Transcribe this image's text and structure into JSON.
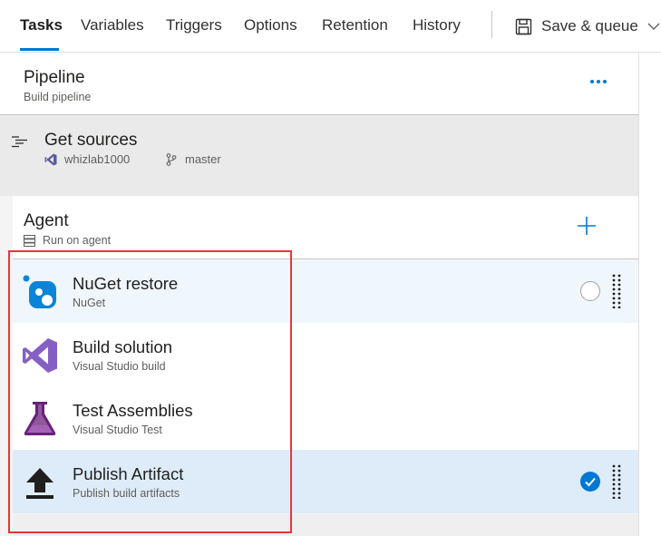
{
  "tabs": [
    {
      "label": "Tasks",
      "active": true
    },
    {
      "label": "Variables",
      "active": false
    },
    {
      "label": "Triggers",
      "active": false
    },
    {
      "label": "Options",
      "active": false
    },
    {
      "label": "Retention",
      "active": false
    },
    {
      "label": "History",
      "active": false
    }
  ],
  "toolbar": {
    "save_label": "Save & queue",
    "save_icon": "save-icon",
    "dropdown_icon": "chevron-down-icon"
  },
  "pipeline": {
    "title": "Pipeline",
    "subtitle": "Build pipeline",
    "more_icon": "more-icon"
  },
  "get_sources": {
    "title": "Get sources",
    "repo": "whizlab1000",
    "branch": "master"
  },
  "agent": {
    "title": "Agent",
    "subtitle": "Run on agent"
  },
  "tasks": [
    {
      "name": "NuGet restore",
      "type": "NuGet",
      "icon": "nuget-icon",
      "state": "hover"
    },
    {
      "name": "Build solution",
      "type": "Visual Studio build",
      "icon": "visual-studio-icon",
      "state": "normal"
    },
    {
      "name": "Test Assemblies",
      "type": "Visual Studio Test",
      "icon": "test-flask-icon",
      "state": "normal"
    },
    {
      "name": "Publish Artifact",
      "type": "Publish build artifacts",
      "icon": "upload-arrow-icon",
      "state": "selected"
    }
  ],
  "colors": {
    "accent": "#0078d4",
    "highlight_box": "#e03a3a",
    "hover_row": "#eff6fc",
    "selected_row": "#deecf9"
  }
}
